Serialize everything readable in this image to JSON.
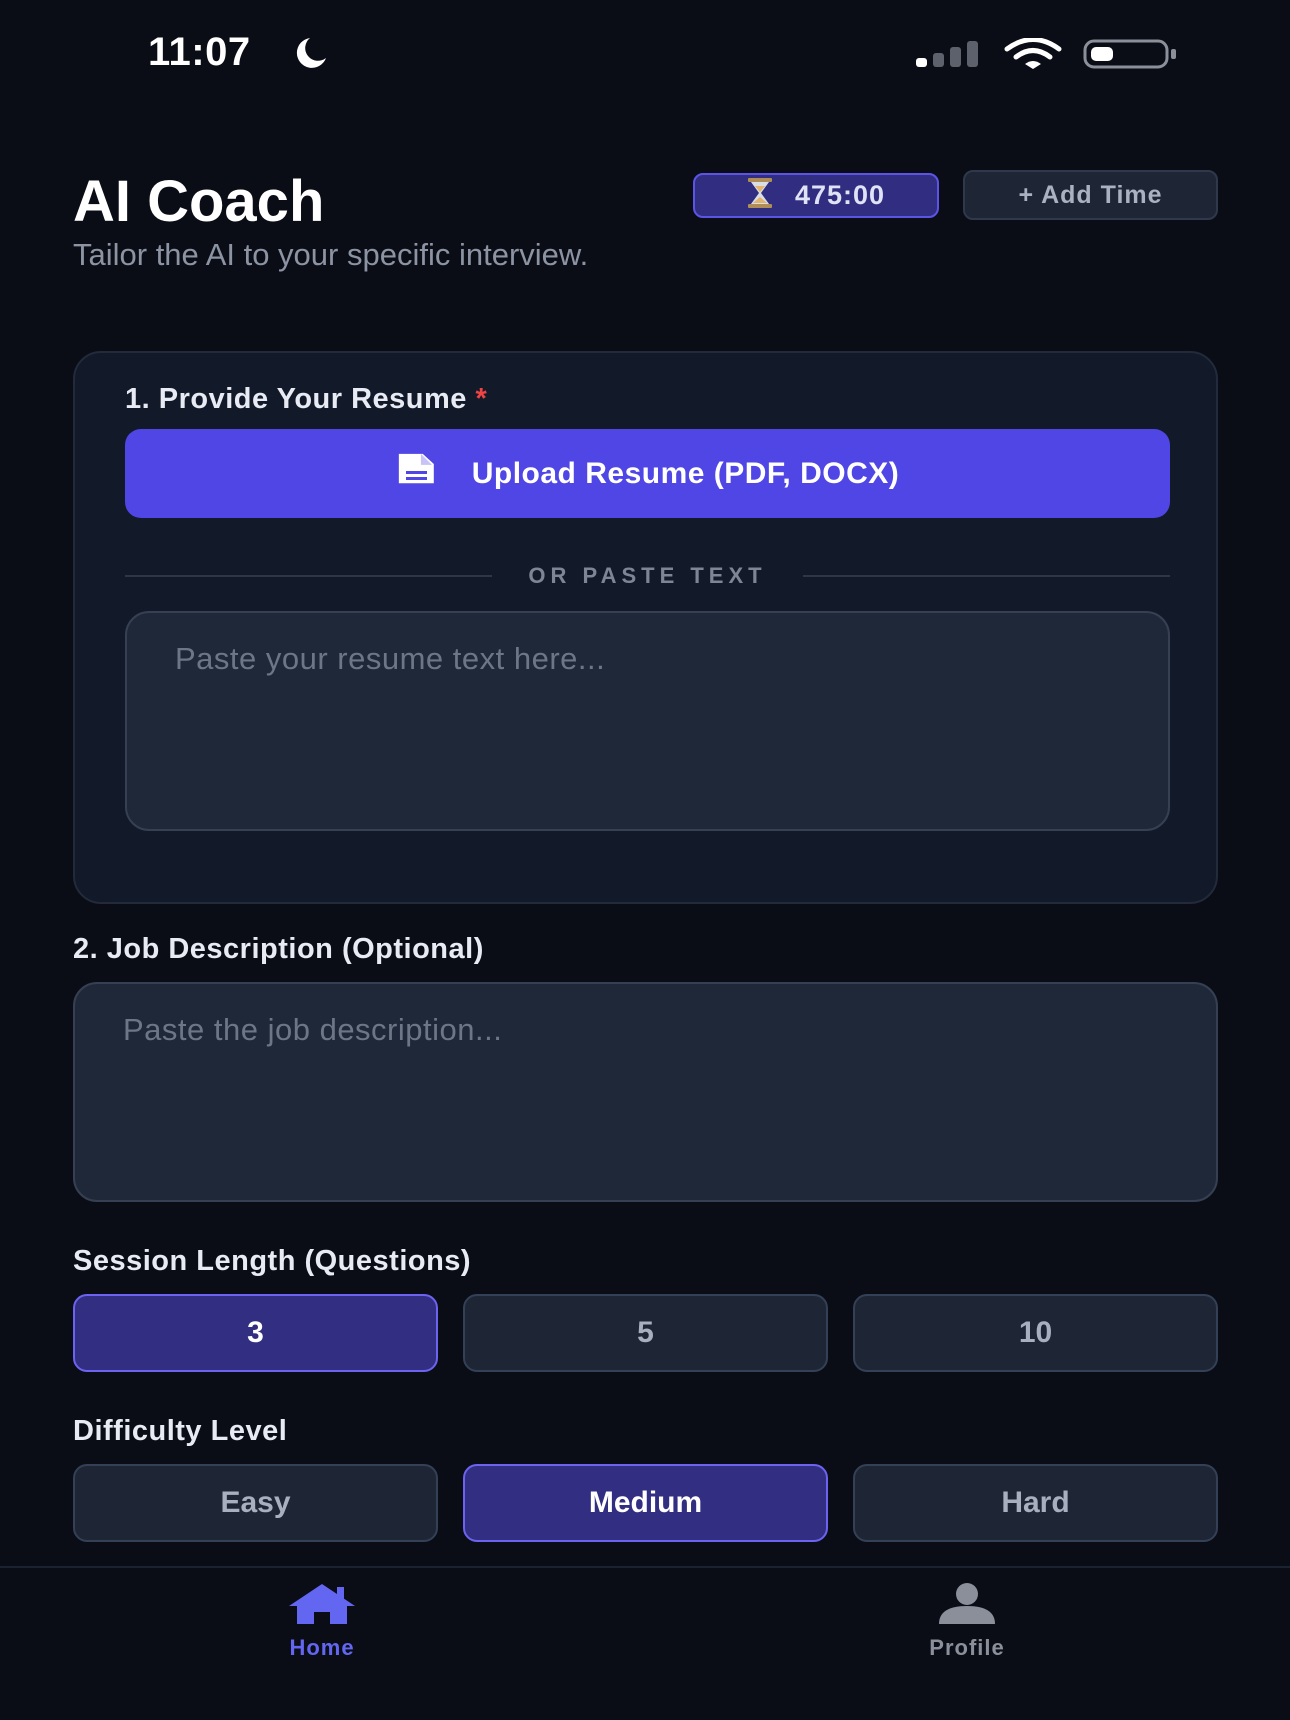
{
  "status_bar": {
    "time": "11:07"
  },
  "header": {
    "title": "AI Coach",
    "subtitle": "Tailor the AI to your specific interview.",
    "timer_icon": "hourglass-icon",
    "timer_value": "475:00",
    "add_time_label": "+ Add Time"
  },
  "resume_section": {
    "label": "1. Provide Your Resume",
    "required_mark": "*",
    "upload_icon": "document-icon",
    "upload_label": "Upload Resume (PDF, DOCX)",
    "divider_text": "OR PASTE TEXT",
    "textarea_placeholder": "Paste your resume text here..."
  },
  "job_section": {
    "label": "2. Job Description (Optional)",
    "textarea_placeholder": "Paste the job description..."
  },
  "session_length": {
    "label": "Session Length (Questions)",
    "options": [
      "3",
      "5",
      "10"
    ],
    "selected": "3"
  },
  "difficulty": {
    "label": "Difficulty Level",
    "options": [
      "Easy",
      "Medium",
      "Hard"
    ],
    "selected": "Medium"
  },
  "bottom_nav": {
    "items": [
      {
        "label": "Home",
        "icon": "home-icon",
        "active": true
      },
      {
        "label": "Profile",
        "icon": "profile-icon",
        "active": false
      }
    ]
  },
  "colors": {
    "background": "#0a0d16",
    "accent": "#4f46e5",
    "selected_option": "#322e82",
    "required": "#ef4444",
    "nav_active": "#6366f1",
    "nav_inactive": "#8a8f99"
  }
}
